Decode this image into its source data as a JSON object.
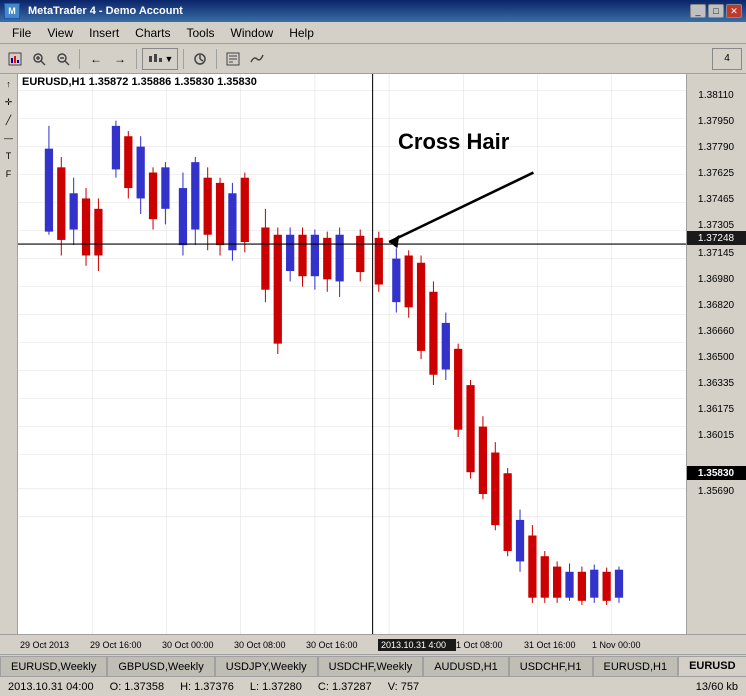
{
  "window": {
    "title": "MetaTrader 4 - Demo Account",
    "icon": "mt4-icon"
  },
  "menu": {
    "items": [
      "File",
      "View",
      "Insert",
      "Charts",
      "Tools",
      "Window",
      "Help"
    ]
  },
  "toolbar": {
    "buttons": [
      "↔",
      "↕",
      "⊕",
      "+",
      "-",
      "←",
      "→",
      "⬛",
      "⊙",
      "⌛",
      "📊",
      "📈"
    ]
  },
  "chart": {
    "symbol": "EURUSD,H1",
    "prices": [
      "1.35872",
      "1.35886",
      "1.35830",
      "1.35830"
    ],
    "header_text": "EURUSD,H1  1.35872 1.35886 1.35830 1.35830",
    "crosshair_label": "Cross Hair",
    "crosshair_price": "1.37248",
    "last_price": "1.35830",
    "price_levels": [
      {
        "price": "1.38110",
        "y_pct": 3
      },
      {
        "price": "1.37950",
        "y_pct": 8
      },
      {
        "price": "1.37790",
        "y_pct": 13
      },
      {
        "price": "1.37625",
        "y_pct": 18
      },
      {
        "price": "1.37465",
        "y_pct": 23
      },
      {
        "price": "1.37305",
        "y_pct": 28
      },
      {
        "price": "1.37248",
        "y_pct": 30.5,
        "type": "crosshair"
      },
      {
        "price": "1.37145",
        "y_pct": 33
      },
      {
        "price": "1.36980",
        "y_pct": 38
      },
      {
        "price": "1.36820",
        "y_pct": 43
      },
      {
        "price": "1.36660",
        "y_pct": 48
      },
      {
        "price": "1.36500",
        "y_pct": 53
      },
      {
        "price": "1.36335",
        "y_pct": 58
      },
      {
        "price": "1.36175",
        "y_pct": 63
      },
      {
        "price": "1.36015",
        "y_pct": 68
      },
      {
        "price": "1.35830",
        "y_pct": 74,
        "type": "last"
      },
      {
        "price": "1.35690",
        "y_pct": 79
      }
    ],
    "time_labels": [
      "29 Oct 2013",
      "29 Oct 16:00",
      "30 Oct 00:00",
      "30 Oct 08:00",
      "30 Oct 16:00",
      "2013.10.31 4:00",
      "1 Oct 08:00",
      "31 Oct 16:00",
      "1 Nov 00:00"
    ],
    "crosshair_time": "2013.10.31 4:00",
    "crosshair_x_pct": 53
  },
  "tabs": {
    "items": [
      {
        "label": "EURUSD,Weekly",
        "active": false
      },
      {
        "label": "GBPUSD,Weekly",
        "active": false
      },
      {
        "label": "USDJPY,Weekly",
        "active": false
      },
      {
        "label": "USDCHF,Weekly",
        "active": false
      },
      {
        "label": "AUDUSD,H1",
        "active": false
      },
      {
        "label": "USDCHF,H1",
        "active": false
      },
      {
        "label": "EURUSD,H1",
        "active": false
      },
      {
        "label": "EURUSD",
        "active": true
      }
    ]
  },
  "status_bar": {
    "datetime": "2013.10.31 04:00",
    "open": "O: 1.37358",
    "high": "H: 1.37376",
    "low": "L: 1.37280",
    "close": "C: 1.37287",
    "volume": "V: 757",
    "memory": "13/60 kb"
  },
  "colors": {
    "bull_candle": "#3333cc",
    "bear_candle": "#cc0000",
    "crosshair": "#000000",
    "background": "#ffffff",
    "grid": "#e0e0e0"
  }
}
